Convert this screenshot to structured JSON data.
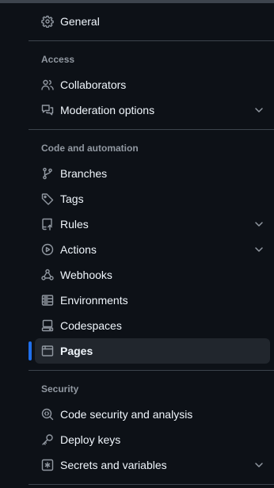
{
  "nav": {
    "general": {
      "label": "General",
      "icon": "gear-icon"
    },
    "access": {
      "heading": "Access",
      "collaborators": {
        "label": "Collaborators",
        "icon": "people-icon"
      },
      "moderation": {
        "label": "Moderation options",
        "icon": "comment-discussion-icon"
      }
    },
    "code_automation": {
      "heading": "Code and automation",
      "branches": {
        "label": "Branches",
        "icon": "git-branch-icon"
      },
      "tags": {
        "label": "Tags",
        "icon": "tag-icon"
      },
      "rules": {
        "label": "Rules",
        "icon": "repo-push-icon"
      },
      "actions": {
        "label": "Actions",
        "icon": "play-icon"
      },
      "webhooks": {
        "label": "Webhooks",
        "icon": "webhook-icon"
      },
      "environments": {
        "label": "Environments",
        "icon": "server-icon"
      },
      "codespaces": {
        "label": "Codespaces",
        "icon": "codespaces-icon"
      },
      "pages": {
        "label": "Pages",
        "icon": "browser-icon",
        "selected": true
      }
    },
    "security": {
      "heading": "Security",
      "code_security": {
        "label": "Code security and analysis",
        "icon": "codescan-icon"
      },
      "deploy_keys": {
        "label": "Deploy keys",
        "icon": "key-icon"
      },
      "secrets": {
        "label": "Secrets and variables",
        "icon": "key-asterisk-icon"
      }
    }
  },
  "colors": {
    "background": "#0d1117",
    "text": "#f0f6fc",
    "muted": "#9198a1",
    "selected_bg": "#21262d",
    "accent": "#1f6feb",
    "divider": "#3d444d"
  }
}
